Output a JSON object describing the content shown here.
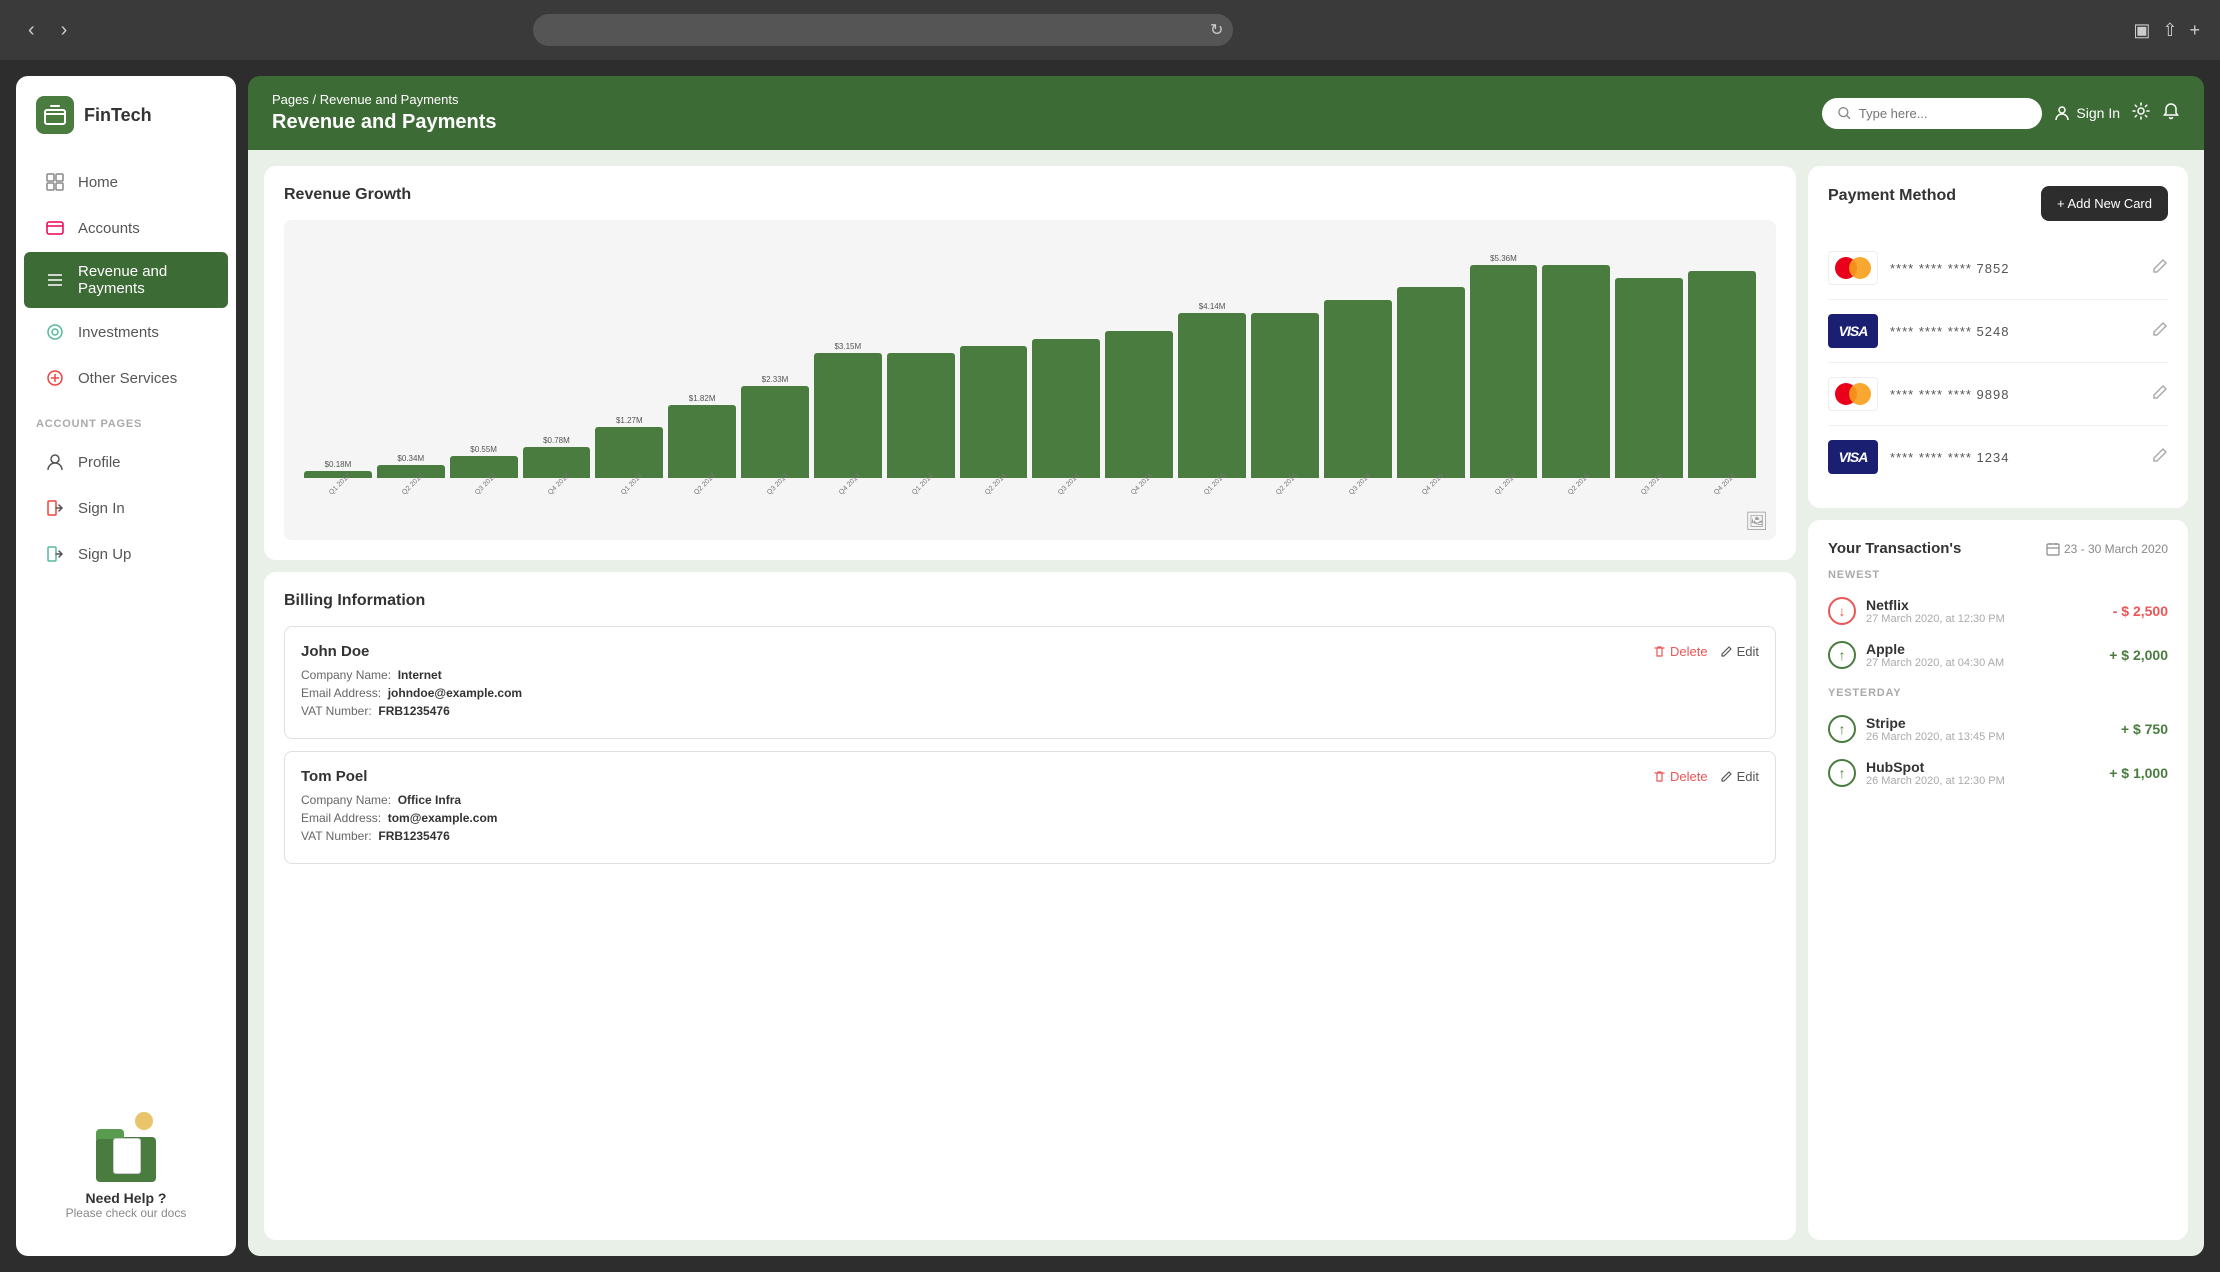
{
  "browser": {
    "address": "",
    "refresh_icon": "↻"
  },
  "sidebar": {
    "logo_text": "FinTech",
    "nav_items": [
      {
        "id": "home",
        "label": "Home",
        "icon": "⊡",
        "active": false
      },
      {
        "id": "accounts",
        "label": "Accounts",
        "icon": "📅",
        "active": false
      },
      {
        "id": "revenue",
        "label": "Revenue and Payments",
        "icon": "≡",
        "active": true
      },
      {
        "id": "investments",
        "label": "Investments",
        "icon": "◎",
        "active": false
      },
      {
        "id": "other",
        "label": "Other Services",
        "icon": "⊕",
        "active": false
      }
    ],
    "account_section_label": "ACCOUNT PAGES",
    "account_items": [
      {
        "id": "profile",
        "label": "Profile",
        "icon": "👤"
      },
      {
        "id": "signin",
        "label": "Sign In",
        "icon": "📋"
      },
      {
        "id": "signup",
        "label": "Sign Up",
        "icon": "📋"
      }
    ],
    "help": {
      "title": "Need Help ?",
      "subtitle": "Please check our docs"
    }
  },
  "header": {
    "breadcrumb_pages": "Pages",
    "breadcrumb_sep": "/",
    "breadcrumb_current": "Revenue and Payments",
    "page_title": "Revenue and Payments",
    "search_placeholder": "Type here...",
    "sign_in_label": "Sign In"
  },
  "revenue_growth": {
    "title": "Revenue Growth",
    "bars": [
      {
        "quarter": "Q1 2012",
        "value": 0.18,
        "label": "$0.18M",
        "height_pct": 3
      },
      {
        "quarter": "Q2 2012",
        "value": 0.34,
        "label": "$0.34M",
        "height_pct": 6
      },
      {
        "quarter": "Q3 2012",
        "value": 0.55,
        "label": "$0.55M",
        "height_pct": 10
      },
      {
        "quarter": "Q4 2012",
        "value": 0.78,
        "label": "$0.78M",
        "height_pct": 14
      },
      {
        "quarter": "Q1 2013",
        "value": 1.27,
        "label": "$1.27M",
        "height_pct": 23
      },
      {
        "quarter": "Q2 2013",
        "value": 1.82,
        "label": "$1.82M",
        "height_pct": 33
      },
      {
        "quarter": "Q3 2013",
        "value": 2.33,
        "label": "$2.33M",
        "height_pct": 42
      },
      {
        "quarter": "Q4 2013",
        "value": 3.15,
        "label": "$3.15M",
        "height_pct": 57
      },
      {
        "quarter": "Q1 2014",
        "value": 3.15,
        "label": "",
        "height_pct": 57
      },
      {
        "quarter": "Q2 2014",
        "value": 3.15,
        "label": "",
        "height_pct": 60
      },
      {
        "quarter": "Q3 2014",
        "value": 3.5,
        "label": "",
        "height_pct": 63
      },
      {
        "quarter": "Q4 2014",
        "value": 3.7,
        "label": "",
        "height_pct": 67
      },
      {
        "quarter": "Q1 2015",
        "value": 4.14,
        "label": "$4.14M",
        "height_pct": 75
      },
      {
        "quarter": "Q2 2015",
        "value": 4.14,
        "label": "",
        "height_pct": 75
      },
      {
        "quarter": "Q3 2015",
        "value": 4.5,
        "label": "",
        "height_pct": 81
      },
      {
        "quarter": "Q4 2015",
        "value": 4.8,
        "label": "",
        "height_pct": 87
      },
      {
        "quarter": "Q1 2016",
        "value": 5.36,
        "label": "$5.36M",
        "height_pct": 97
      },
      {
        "quarter": "Q2 2016",
        "value": 5.36,
        "label": "",
        "height_pct": 97
      },
      {
        "quarter": "Q3 2016",
        "value": 5.0,
        "label": "",
        "height_pct": 91
      },
      {
        "quarter": "Q4 2016",
        "value": 5.2,
        "label": "",
        "height_pct": 94
      }
    ]
  },
  "payment_methods": {
    "title": "Payment Method",
    "add_button": "+ Add New Card",
    "cards": [
      {
        "type": "mastercard",
        "digits": "7852",
        "masked": "**** **** ****"
      },
      {
        "type": "visa",
        "digits": "5248",
        "masked": "**** **** ****"
      },
      {
        "type": "mastercard",
        "digits": "9898",
        "masked": "**** **** ****"
      },
      {
        "type": "visa",
        "digits": "1234",
        "masked": "**** **** ****"
      }
    ]
  },
  "billing": {
    "title": "Billing Information",
    "entries": [
      {
        "name": "John Doe",
        "company_label": "Company Name:",
        "company": "Internet",
        "email_label": "Email Address:",
        "email": "johndoe@example.com",
        "vat_label": "VAT Number:",
        "vat": "FRB1235476"
      },
      {
        "name": "Tom Poel",
        "company_label": "Company Name:",
        "company": "Office Infra",
        "email_label": "Email Address:",
        "email": "tom@example.com",
        "vat_label": "VAT Number:",
        "vat": "FRB1235476"
      }
    ],
    "delete_label": "Delete",
    "edit_label": "Edit"
  },
  "transactions": {
    "title": "Your Transaction's",
    "date_range": "23 - 30 March 2020",
    "sections": [
      {
        "label": "NEWEST",
        "items": [
          {
            "name": "Netflix",
            "date": "27 March 2020, at 12:30 PM",
            "amount": "- $ 2,500",
            "type": "negative"
          },
          {
            "name": "Apple",
            "date": "27 March 2020, at 04:30 AM",
            "amount": "+ $ 2,000",
            "type": "positive"
          }
        ]
      },
      {
        "label": "YESTERDAY",
        "items": [
          {
            "name": "Stripe",
            "date": "26 March 2020, at 13:45 PM",
            "amount": "+ $ 750",
            "type": "positive"
          },
          {
            "name": "HubSpot",
            "date": "26 March 2020, at 12:30 PM",
            "amount": "+ $ 1,000",
            "type": "positive"
          }
        ]
      }
    ]
  }
}
